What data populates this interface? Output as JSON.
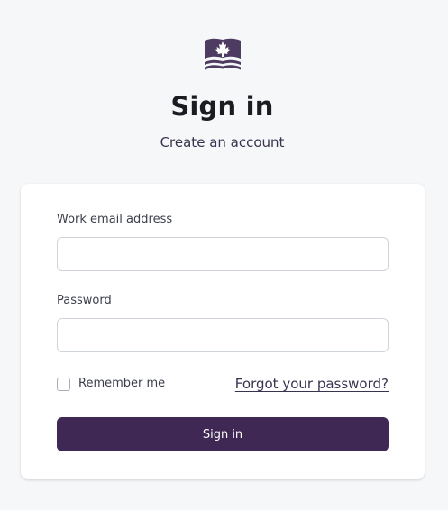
{
  "header": {
    "logo_icon": "maple-leaf-flag-icon",
    "title": "Sign in",
    "create_account_link": "Create an account"
  },
  "form": {
    "email_label": "Work email address",
    "email_value": "",
    "password_label": "Password",
    "password_value": "",
    "remember_label": "Remember me",
    "remember_checked": false,
    "forgot_link": "Forgot your password?",
    "submit_label": "Sign in"
  },
  "colors": {
    "brand": "#3f2853",
    "background": "#f6f7f9",
    "card": "#ffffff"
  }
}
